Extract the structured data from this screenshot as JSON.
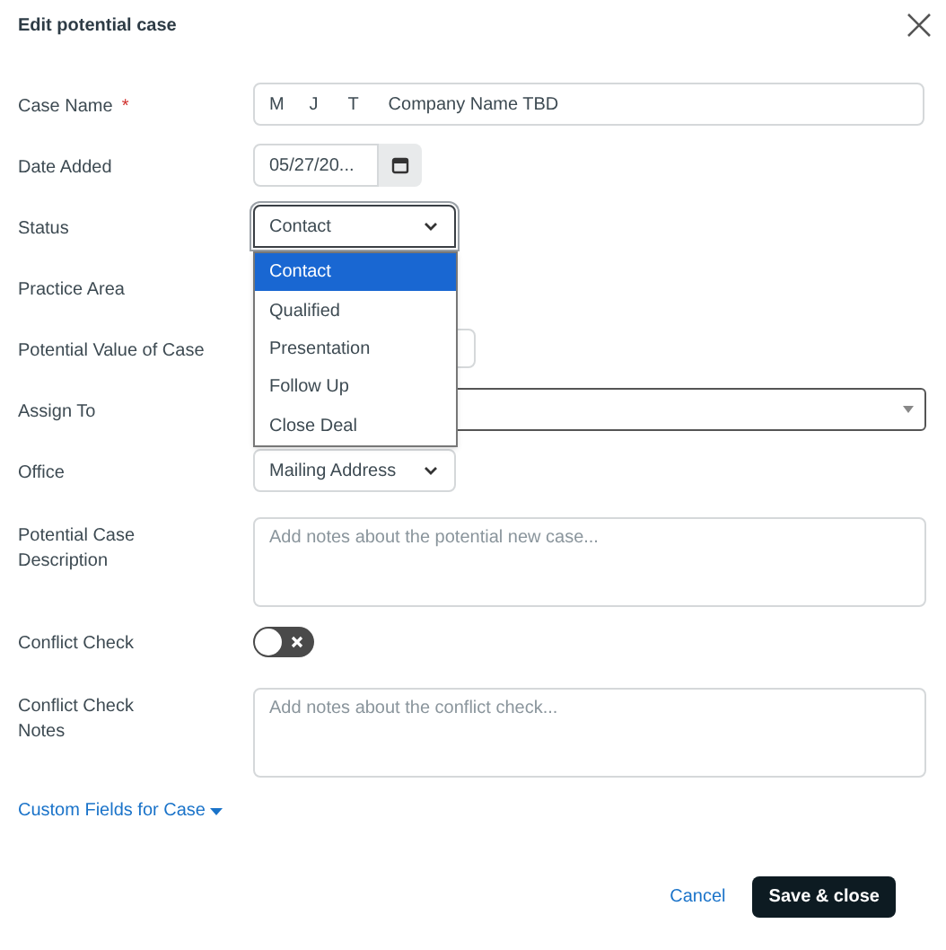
{
  "dialog": {
    "title": "Edit potential case"
  },
  "fields": [
    {
      "kind": "text",
      "label": "Case Name",
      "required_mark": "*",
      "value": "M     J      T      Company Name TBD"
    },
    {
      "kind": "date",
      "label": "Date Added",
      "value": "05/27/20..."
    },
    {
      "kind": "select",
      "label": "Status",
      "value": "Contact",
      "focused": true,
      "expanded": true,
      "options": [
        {
          "label": "Contact",
          "selected": true
        },
        {
          "label": "Qualified",
          "selected": false
        },
        {
          "label": "Presentation",
          "selected": false
        },
        {
          "label": "Follow Up",
          "selected": false
        },
        {
          "label": "Close Deal",
          "selected": false
        }
      ]
    },
    {
      "kind": "covered",
      "label": "Practice Area"
    },
    {
      "kind": "short",
      "label": "Potential Value of Case"
    },
    {
      "kind": "combo",
      "label": "Assign To"
    },
    {
      "kind": "select",
      "label": "Office",
      "value": "Mailing Address",
      "focused": false
    },
    {
      "kind": "textarea",
      "label": "Potential Case Description",
      "placeholder": "Add notes about the potential new case..."
    },
    {
      "kind": "toggle",
      "label": "Conflict Check",
      "on": false
    },
    {
      "kind": "textarea",
      "label": "Conflict Check Notes",
      "placeholder": "Add notes about the conflict check..."
    }
  ],
  "custom_fields_link": "Custom Fields for Case",
  "buttons": {
    "cancel": "Cancel",
    "save": "Save & close"
  }
}
